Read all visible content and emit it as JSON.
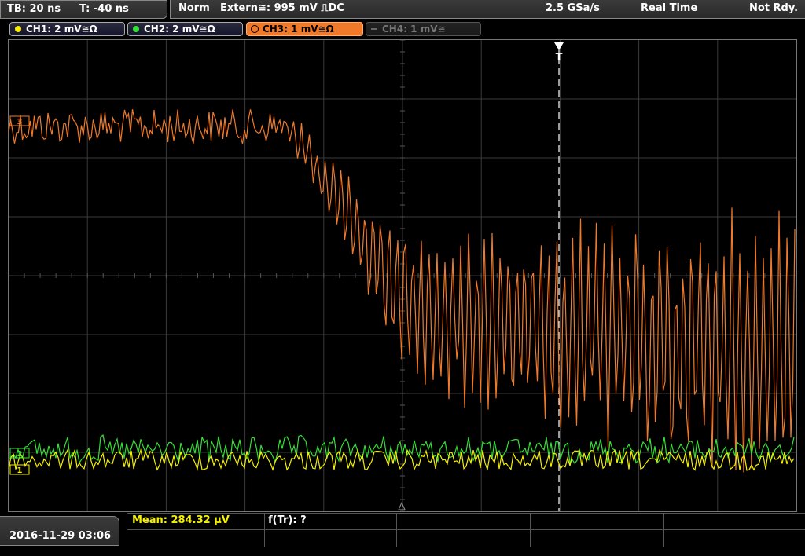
{
  "topbar": {
    "timebase": "TB: 20 ns",
    "trigger_time": "T: -40 ns",
    "mode": "Norm",
    "trigger_source": "Extern≅: 995 mV ⎍DC",
    "sample_rate": "2.5 GSa/s",
    "acquisition": "Real Time",
    "status": "Not Rdy."
  },
  "channels": [
    {
      "label": "CH1: 2 mV≅Ω",
      "color": "#f4f000",
      "state": "on"
    },
    {
      "label": "CH2: 2 mV≅Ω",
      "color": "#35e036",
      "state": "on"
    },
    {
      "label": "CH3: 1 mV≅Ω",
      "color": "#f07a2a",
      "state": "active"
    },
    {
      "label": "CH4: 1 mV≅",
      "color": "#666666",
      "state": "off"
    }
  ],
  "markers": {
    "ch3_marker": "3",
    "ch2_marker": "2",
    "ch1_marker": "1",
    "trigger_marker": "T"
  },
  "colors": {
    "ch1": "#f4f000",
    "ch2": "#35e036",
    "ch3": "#f07a2a",
    "grid": "#3a3a3a",
    "trigger_line": "#ffffff"
  },
  "bottombar": {
    "datetime": "2016-11-29 03:06",
    "meas1": "Mean: 284.32 µV",
    "meas2": "f(Tr): ?"
  }
}
